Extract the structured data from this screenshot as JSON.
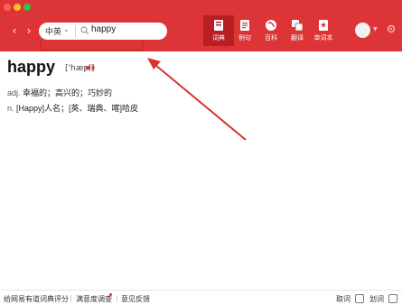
{
  "app": {
    "accent": "#dd3437"
  },
  "window": {
    "traffic_lights": [
      "#ff5f57",
      "#febc2e",
      "#28c840"
    ]
  },
  "nav": {
    "back_icon": "chevron-left-icon",
    "forward_icon": "chevron-right-icon"
  },
  "search": {
    "language": "中英",
    "query": "happy"
  },
  "toolbar": [
    {
      "label": "词典",
      "icon": "dictionary-icon",
      "active": true
    },
    {
      "label": "例句",
      "icon": "sentence-icon",
      "active": false
    },
    {
      "label": "百科",
      "icon": "encyclopedia-icon",
      "active": false
    },
    {
      "label": "翻译",
      "icon": "translate-icon",
      "active": false
    },
    {
      "label": "单词本",
      "icon": "wordbook-icon",
      "active": false
    }
  ],
  "entry": {
    "word": "happy",
    "phonetic": "['hæpi]",
    "definitions": [
      {
        "pos": "adj.",
        "meaning": "幸福的；高兴的；巧妙的"
      },
      {
        "pos": "n.",
        "meaning": "[Happy]人名；[英、瑞典、喀]哈皮"
      }
    ]
  },
  "annotation": {
    "color": "#d8322f"
  },
  "footer": {
    "rate": "给网易有道词典评分",
    "survey": "满意度调查",
    "feedback": "意见反馈",
    "screen_word": "取词",
    "select_word": "划词"
  }
}
